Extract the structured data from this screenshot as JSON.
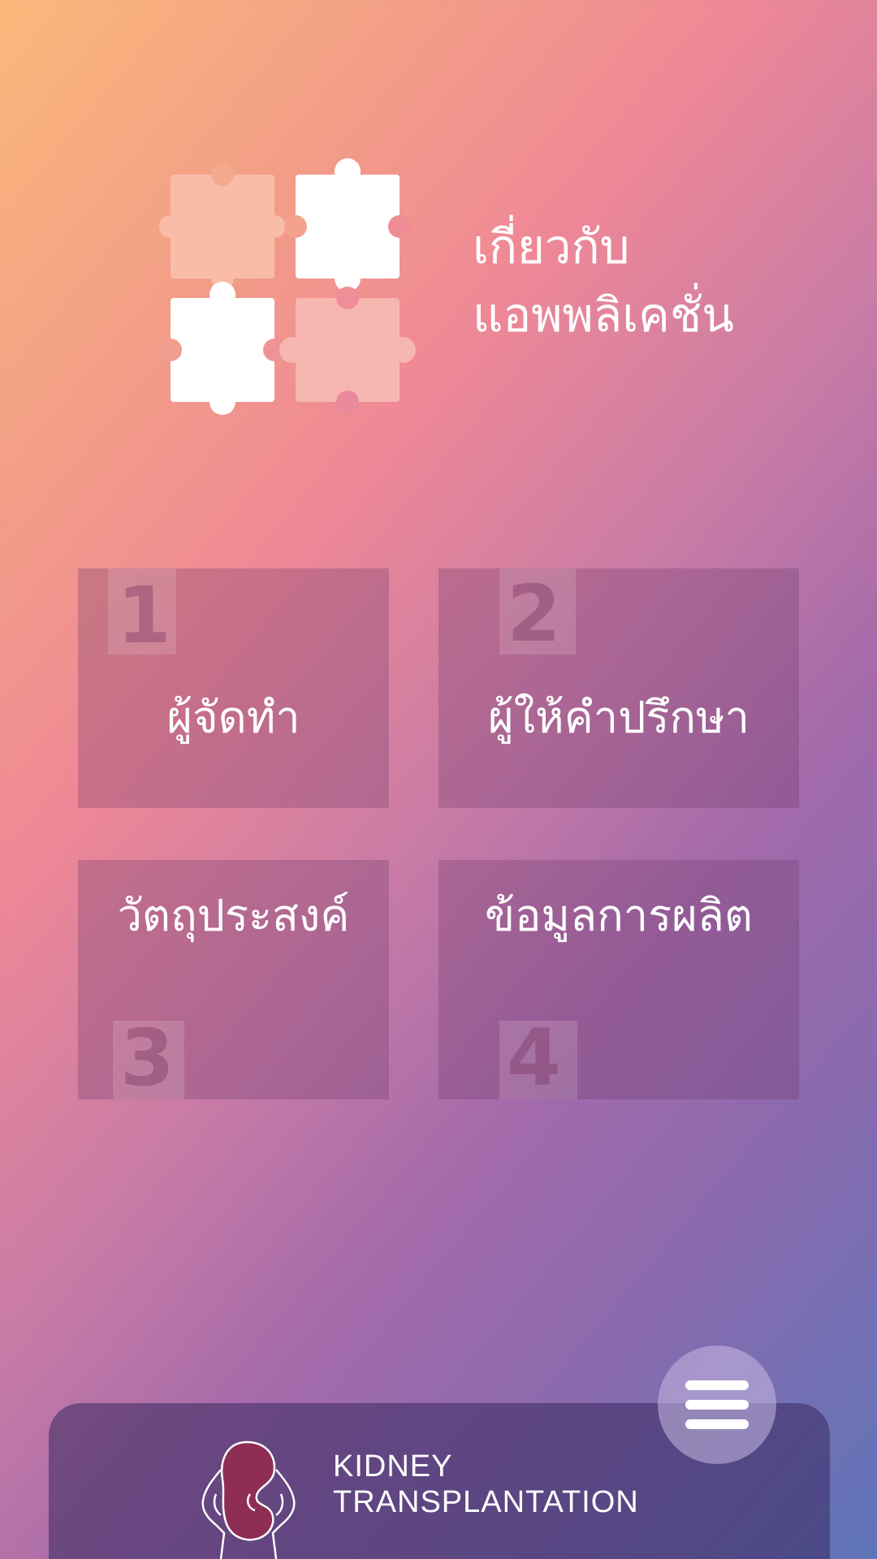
{
  "header": {
    "title_line1": "เกี่ยวกับ",
    "title_line2": "แอพพลิเคชั่น",
    "icon": "puzzle-pieces-icon"
  },
  "menu": [
    {
      "number": "1",
      "label": "ผู้จัดทำ"
    },
    {
      "number": "2",
      "label": "ผู้ให้คำปรึกษา"
    },
    {
      "number": "3",
      "label": "วัตถุประสงค์"
    },
    {
      "number": "4",
      "label": "ข้อมูลการผลิต"
    }
  ],
  "bottom_bar": {
    "brand_line1": "KIDNEY",
    "brand_line2": "TRANSPLANTATION",
    "logo_icon": "hands-holding-kidney-icon",
    "menu_icon": "hamburger-menu-icon"
  },
  "colors": {
    "gradient_start": "#fbb77a",
    "gradient_mid": "#ef8896",
    "gradient_end": "#5f75b9",
    "kidney": "#8e2e55",
    "text": "#ffffff"
  }
}
